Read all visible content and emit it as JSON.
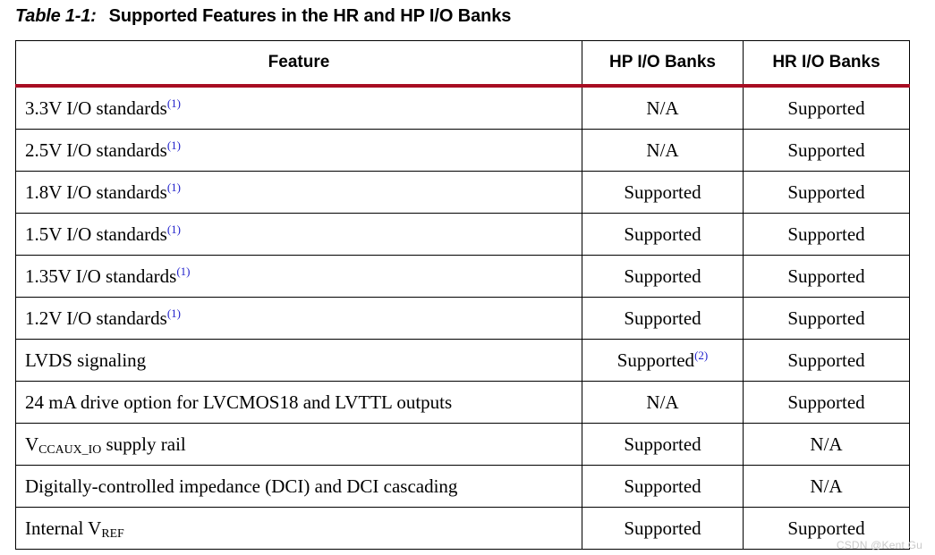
{
  "caption": {
    "label": "Table 1-1:",
    "title": "Supported Features in the HR and HP I/O Banks"
  },
  "colors": {
    "header_rule": "#A80C22",
    "footnote_marker": "#2222CC",
    "border": "#000000",
    "text": "#000000",
    "watermark": "#c9c9c9"
  },
  "table": {
    "columns": [
      {
        "key": "feature",
        "label": "Feature",
        "align": "center"
      },
      {
        "key": "hp",
        "label": "HP I/O Banks",
        "align": "center"
      },
      {
        "key": "hr",
        "label": "HR I/O Banks",
        "align": "center"
      }
    ],
    "rows": [
      {
        "feature": "3.3V I/O standards",
        "feature_footnote": "(1)",
        "hp": "N/A",
        "hp_footnote": "",
        "hr": "Supported",
        "hr_footnote": ""
      },
      {
        "feature": "2.5V I/O standards",
        "feature_footnote": "(1)",
        "hp": "N/A",
        "hp_footnote": "",
        "hr": "Supported",
        "hr_footnote": ""
      },
      {
        "feature": "1.8V I/O standards",
        "feature_footnote": "(1)",
        "hp": "Supported",
        "hp_footnote": "",
        "hr": "Supported",
        "hr_footnote": ""
      },
      {
        "feature": "1.5V I/O standards",
        "feature_footnote": "(1)",
        "hp": "Supported",
        "hp_footnote": "",
        "hr": "Supported",
        "hr_footnote": ""
      },
      {
        "feature": "1.35V I/O standards",
        "feature_footnote": "(1)",
        "hp": "Supported",
        "hp_footnote": "",
        "hr": "Supported",
        "hr_footnote": ""
      },
      {
        "feature": "1.2V I/O standards",
        "feature_footnote": "(1)",
        "hp": "Supported",
        "hp_footnote": "",
        "hr": "Supported",
        "hr_footnote": ""
      },
      {
        "feature": "LVDS signaling",
        "feature_footnote": "",
        "hp": "Supported",
        "hp_footnote": "(2)",
        "hr": "Supported",
        "hr_footnote": ""
      },
      {
        "feature": "24 mA drive option for LVCMOS18 and LVTTL outputs",
        "feature_footnote": "",
        "hp": "N/A",
        "hp_footnote": "",
        "hr": "Supported",
        "hr_footnote": ""
      },
      {
        "feature": "V",
        "feature_sub": "CCAUX_IO",
        "feature_tail": " supply rail",
        "feature_footnote": "",
        "hp": "Supported",
        "hp_footnote": "",
        "hr": "N/A",
        "hr_footnote": ""
      },
      {
        "feature": "Digitally-controlled impedance (DCI) and DCI cascading",
        "feature_footnote": "",
        "hp": "Supported",
        "hp_footnote": "",
        "hr": "N/A",
        "hr_footnote": ""
      },
      {
        "feature": "Internal V",
        "feature_sub": "REF",
        "feature_tail": "",
        "feature_footnote": "",
        "hp": "Supported",
        "hp_footnote": "",
        "hr": "Supported",
        "hr_footnote": ""
      }
    ]
  },
  "watermark": {
    "text": "CSDN @Kent Gu"
  }
}
